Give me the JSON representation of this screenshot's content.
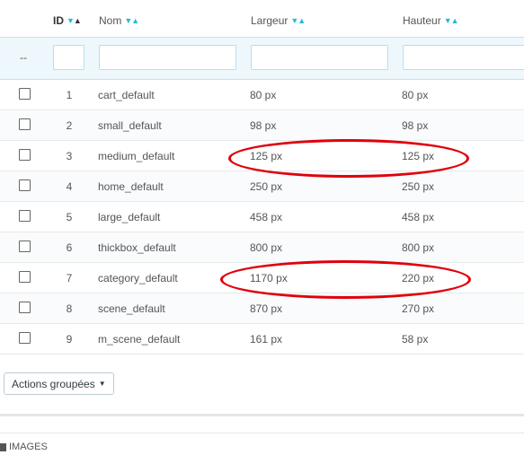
{
  "table": {
    "columns": {
      "id": "ID",
      "name": "Nom",
      "width": "Largeur",
      "height": "Hauteur"
    },
    "filter_placeholder": "--",
    "rows": [
      {
        "id": "1",
        "name": "cart_default",
        "width": "80 px",
        "height": "80 px"
      },
      {
        "id": "2",
        "name": "small_default",
        "width": "98 px",
        "height": "98 px"
      },
      {
        "id": "3",
        "name": "medium_default",
        "width": "125 px",
        "height": "125 px"
      },
      {
        "id": "4",
        "name": "home_default",
        "width": "250 px",
        "height": "250 px"
      },
      {
        "id": "5",
        "name": "large_default",
        "width": "458 px",
        "height": "458 px"
      },
      {
        "id": "6",
        "name": "thickbox_default",
        "width": "800 px",
        "height": "800 px"
      },
      {
        "id": "7",
        "name": "category_default",
        "width": "1170 px",
        "height": "220 px"
      },
      {
        "id": "8",
        "name": "scene_default",
        "width": "870 px",
        "height": "270 px"
      },
      {
        "id": "9",
        "name": "m_scene_default",
        "width": "161 px",
        "height": "58 px"
      }
    ]
  },
  "bulk_actions_label": "Actions groupées",
  "footer": {
    "section_title": "IMAGES"
  },
  "colors": {
    "accent": "#25b9d7",
    "highlight": "#e0000b",
    "filter_bg": "#eef8fc"
  }
}
